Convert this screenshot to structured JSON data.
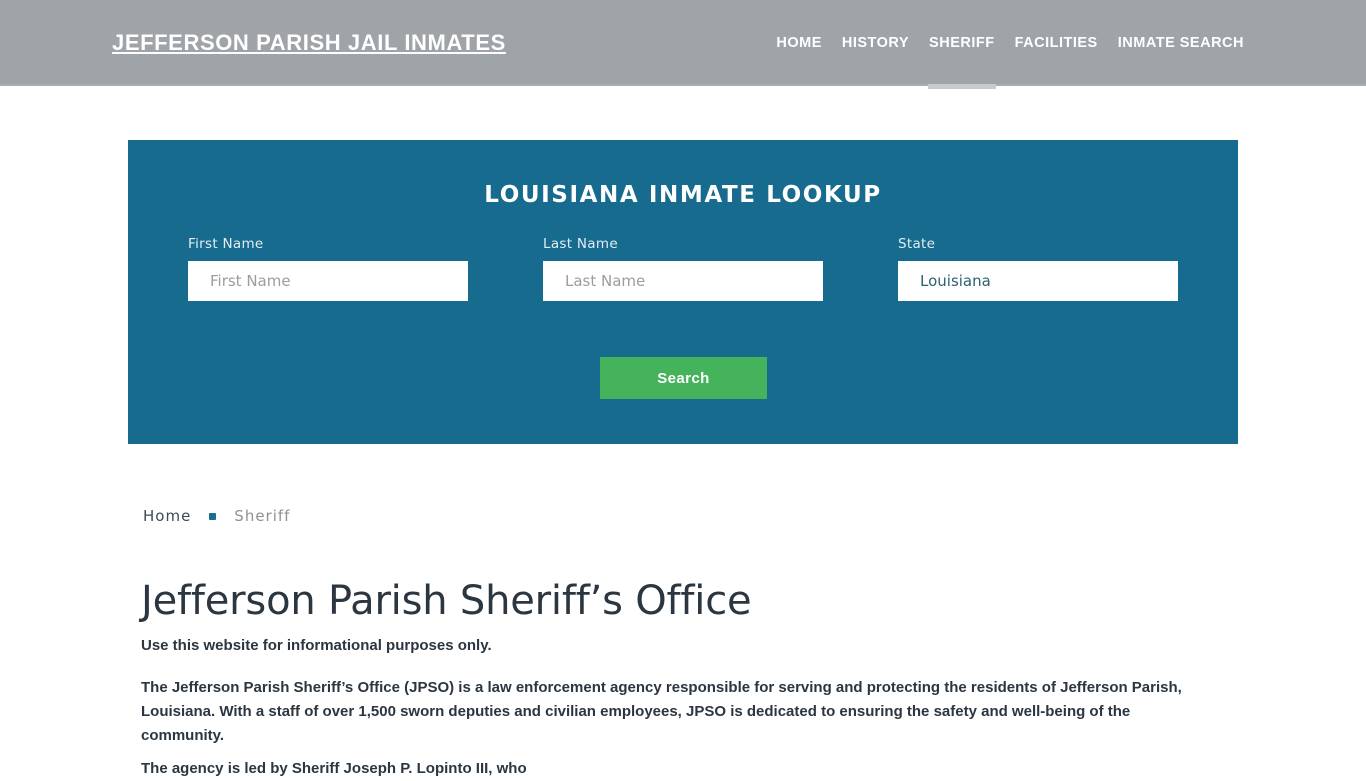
{
  "header": {
    "brand": "JEFFERSON PARISH JAIL INMATES",
    "nav": [
      {
        "label": "HOME",
        "active": false
      },
      {
        "label": "HISTORY",
        "active": false
      },
      {
        "label": "SHERIFF",
        "active": true
      },
      {
        "label": "FACILITIES",
        "active": false
      },
      {
        "label": "INMATE SEARCH",
        "active": false
      }
    ]
  },
  "lookup": {
    "title": "LOUISIANA INMATE LOOKUP",
    "first_name_label": "First Name",
    "first_name_placeholder": "First Name",
    "first_name_value": "",
    "last_name_label": "Last Name",
    "last_name_placeholder": "Last Name",
    "last_name_value": "",
    "state_label": "State",
    "state_value": "Louisiana",
    "state_options": [
      "Louisiana"
    ],
    "search_label": "Search"
  },
  "breadcrumb": {
    "home": "Home",
    "separator": "•",
    "current": "Sheriff"
  },
  "article": {
    "title": "Jefferson Parish Sheriff’s Office",
    "lead": "Use this website for informational purposes only.",
    "paragraph": "The Jefferson Parish Sheriff’s Office (JPSO) is a law enforcement agency responsible for serving and protecting the residents of Jefferson Parish, Louisiana. With a staff of over 1,500 sworn deputies and civilian employees, JPSO is dedicated to ensuring the safety and well-being of the community.",
    "paragraph_2": "The agency is led by Sheriff Joseph P. Lopinto III, who"
  },
  "colors": {
    "header_bg": "#9fa4a8",
    "panel_bg": "#176b8e",
    "accent_green": "#45b35c",
    "breadcrumb_dot": "#1b6e8e",
    "text_dark": "#2b3640"
  }
}
